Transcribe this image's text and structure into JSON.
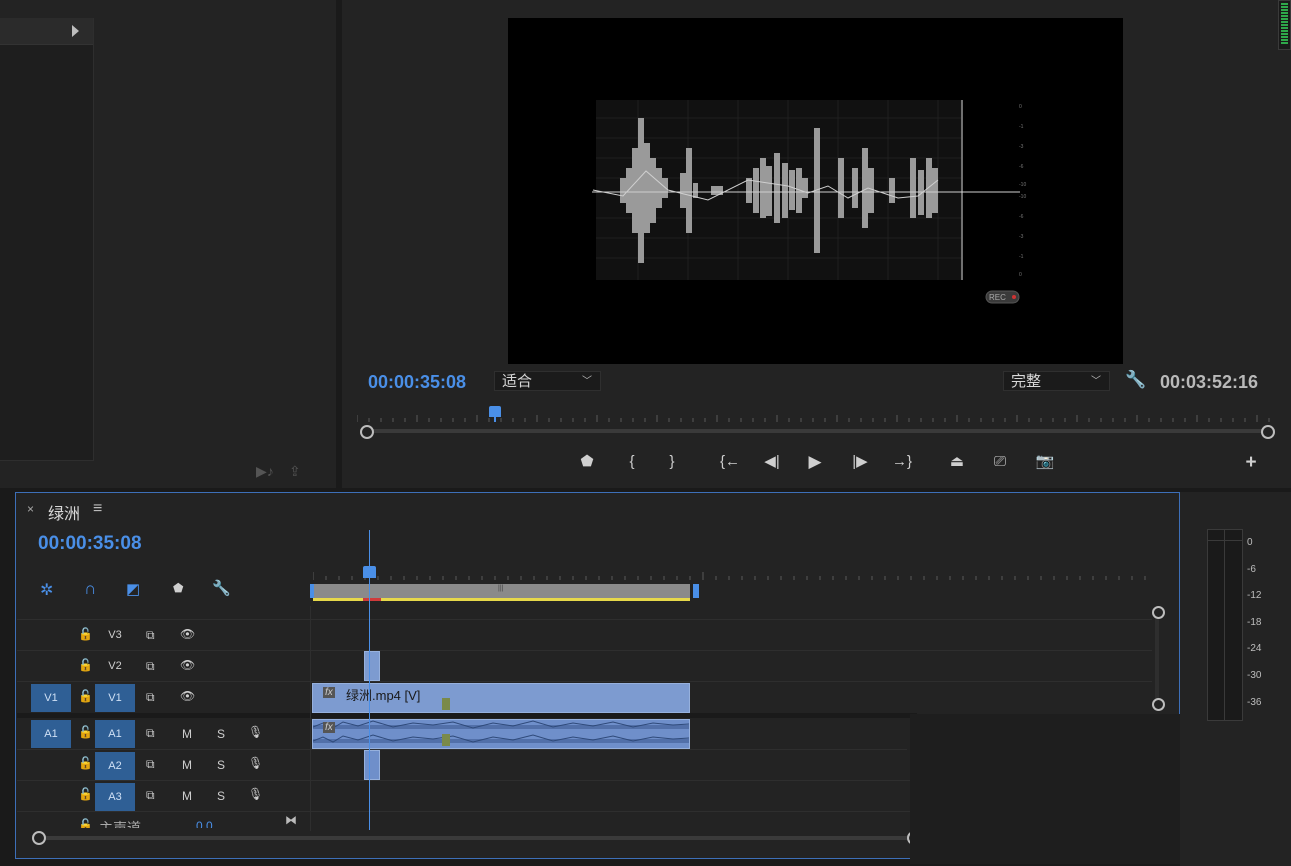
{
  "program_monitor": {
    "timecode": "00:00:35:08",
    "fit_select": "适合",
    "quality_select": "完整",
    "duration": "00:03:52:16",
    "rec_badge": "REC"
  },
  "timeline": {
    "close_label": "×",
    "sequence_name": "绿洲",
    "menu_label": "≡",
    "timecode": "00:00:35:08",
    "tracks": {
      "v3": "V3",
      "v2": "V2",
      "v1_source": "V1",
      "v1": "V1",
      "a1_source": "A1",
      "a1": "A1",
      "a2": "A2",
      "a3": "A3",
      "mute": "M",
      "solo": "S"
    },
    "master_label": "主声道",
    "master_value": "0.0",
    "clip_video_name": "绿洲.mp4 [V]",
    "clip_fx": "fx"
  },
  "audio_meter": {
    "scale": [
      "0",
      "-6",
      "-12",
      "-18",
      "-24",
      "-30",
      "-36"
    ]
  },
  "colors": {
    "accent_blue": "#4a8fe7",
    "video_clip": "#7d9bd0",
    "track_target": "#2f5f95"
  }
}
